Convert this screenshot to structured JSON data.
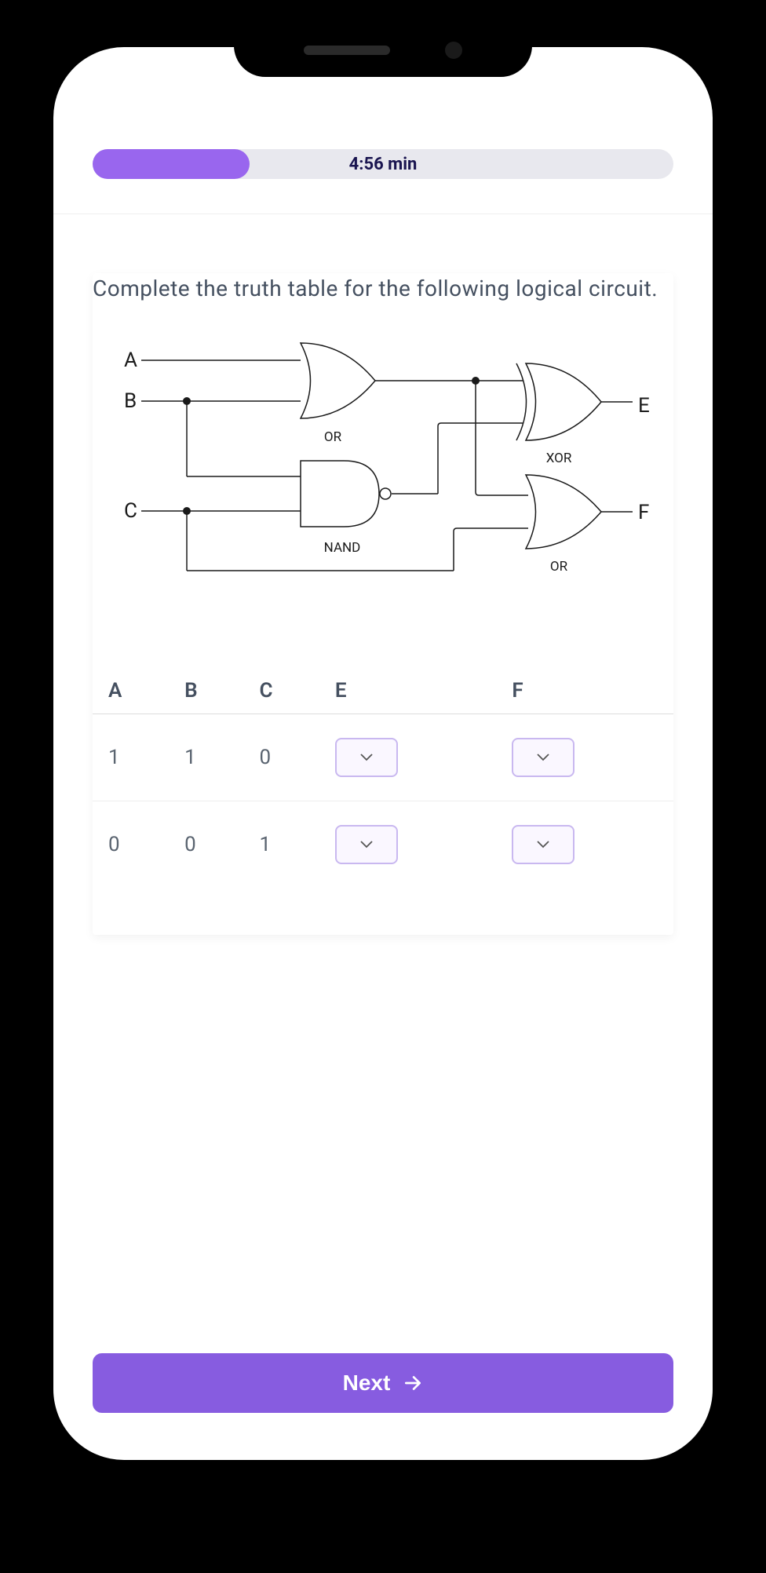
{
  "timer": {
    "text": "4:56 min",
    "progress_percent": 27
  },
  "question": {
    "prompt": "Complete the truth table for the following logical circuit."
  },
  "circuit": {
    "inputs": [
      "A",
      "B",
      "C"
    ],
    "outputs": [
      "E",
      "F"
    ],
    "gates": [
      {
        "label": "OR"
      },
      {
        "label": "NAND"
      },
      {
        "label": "XOR"
      },
      {
        "label": "OR"
      }
    ]
  },
  "truth_table": {
    "headers": [
      "A",
      "B",
      "C",
      "E",
      "F"
    ],
    "rows": [
      {
        "A": "1",
        "B": "1",
        "C": "0",
        "E": "",
        "F": ""
      },
      {
        "A": "0",
        "B": "0",
        "C": "1",
        "E": "",
        "F": ""
      }
    ]
  },
  "next_button": {
    "label": "Next"
  }
}
